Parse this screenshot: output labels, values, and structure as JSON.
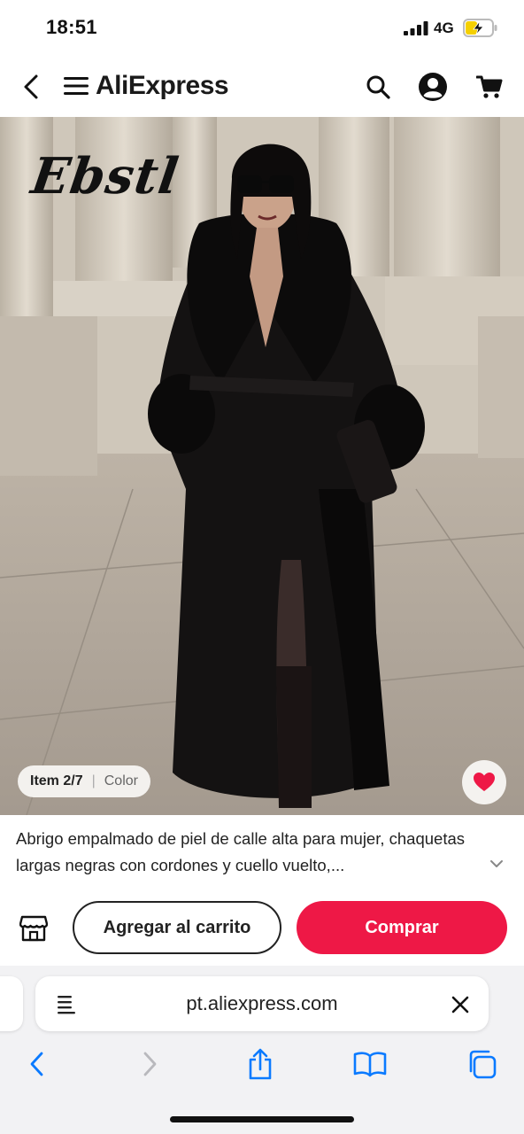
{
  "status_bar": {
    "time": "18:51",
    "network": "4G",
    "battery_charging": true,
    "battery_level": 0.45,
    "battery_color": "#f5d000"
  },
  "header": {
    "logo_text": "AliExpress",
    "back_icon": "chevron-left-icon",
    "menu_icon": "hamburger-menu-icon",
    "search_icon": "search-icon",
    "account_icon": "user-circle-icon",
    "cart_icon": "cart-icon"
  },
  "product": {
    "image_description_icon": "product-photo",
    "watermark_text": "Ebstl",
    "item_badge": {
      "item_label": "Item 2/7",
      "separator": "|",
      "color_label": "Color"
    },
    "wishlist_icon": "heart-icon",
    "title": "Abrigo empalmado de piel de calle alta para mujer, chaquetas largas negras con cordones y cuello vuelto,...",
    "expand_icon": "chevron-down-icon"
  },
  "actions": {
    "store_icon": "store-icon",
    "add_to_cart_label": "Agregar al carrito",
    "buy_label": "Comprar",
    "accent_color": "#ee1846"
  },
  "browser": {
    "url": "pt.aliexpress.com",
    "reader_icon": "page-format-icon",
    "clear_icon": "close-icon",
    "toolbar": [
      "back-arrow-icon",
      "forward-arrow-icon",
      "share-icon",
      "bookmarks-icon",
      "tabs-icon"
    ],
    "toolbar_color": "#0a7aff"
  }
}
